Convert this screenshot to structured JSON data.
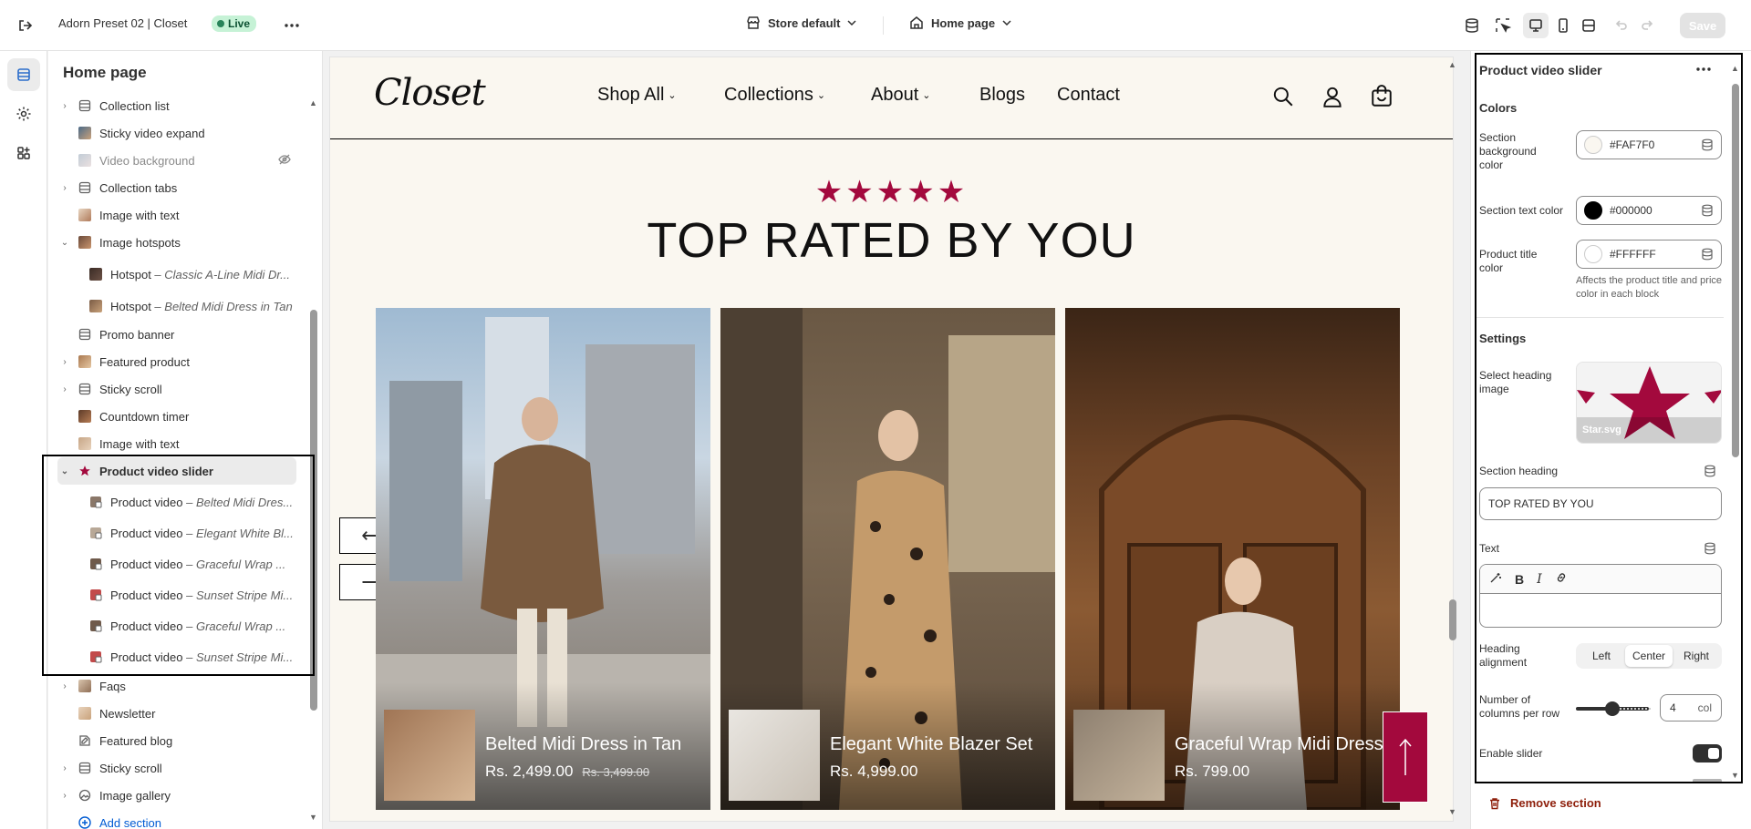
{
  "topbar": {
    "store_title": "Adorn Preset 02 | Closet",
    "live_label": "Live",
    "store_selector": "Store default",
    "page_selector": "Home page",
    "save_label": "Save"
  },
  "sidebar": {
    "title": "Home page",
    "items": [
      {
        "label": "Collection list"
      },
      {
        "label": "Sticky video expand"
      },
      {
        "label": "Video background"
      },
      {
        "label": "Collection tabs"
      },
      {
        "label": "Image with text"
      },
      {
        "label": "Image hotspots"
      },
      {
        "label": "Hotspot",
        "sub": "Classic A-Line Midi Dr..."
      },
      {
        "label": "Hotspot",
        "sub": "Belted Midi Dress in Tan"
      },
      {
        "label": "Promo banner"
      },
      {
        "label": "Featured product"
      },
      {
        "label": "Sticky scroll"
      },
      {
        "label": "Countdown timer"
      },
      {
        "label": "Image with text"
      },
      {
        "label": "Product video slider"
      },
      {
        "label": "Product video",
        "sub": "Belted Midi Dres..."
      },
      {
        "label": "Product video",
        "sub": "Elegant White Bl..."
      },
      {
        "label": "Product video",
        "sub": "Graceful Wrap ..."
      },
      {
        "label": "Product video",
        "sub": "Sunset Stripe Mi..."
      },
      {
        "label": "Product video",
        "sub": "Graceful Wrap ..."
      },
      {
        "label": "Product video",
        "sub": "Sunset Stripe Mi..."
      },
      {
        "label": "Faqs"
      },
      {
        "label": "Newsletter"
      },
      {
        "label": "Featured blog"
      },
      {
        "label": "Sticky scroll"
      },
      {
        "label": "Image gallery"
      },
      {
        "label": "Add section"
      }
    ]
  },
  "preview": {
    "logo": "Closet",
    "nav": [
      "Shop All",
      "Collections",
      "About",
      "Blogs",
      "Contact"
    ],
    "stars": "★★★★★",
    "heading": "TOP RATED BY YOU",
    "arrows": {
      "prev": "⟵",
      "next": "⟶"
    },
    "products": [
      {
        "title": "Belted Midi Dress in Tan",
        "price": "Rs. 2,499.00",
        "compare": "Rs. 3,499.00"
      },
      {
        "title": "Elegant White Blazer Set",
        "price": "Rs. 4,999.00",
        "compare": ""
      },
      {
        "title": "Graceful Wrap Midi Dress",
        "price": "Rs. 799.00",
        "compare": ""
      }
    ]
  },
  "inspector": {
    "title": "Product video slider",
    "colors_heading": "Colors",
    "bg_color_label": "Section background color",
    "bg_color_value": "#FAF7F0",
    "text_color_label": "Section text color",
    "text_color_value": "#000000",
    "title_color_label": "Product title color",
    "title_color_value": "#FFFFFF",
    "title_color_help": "Affects the product title and price color in each block",
    "settings_heading": "Settings",
    "heading_image_label": "Select heading image",
    "heading_image_file": "Star.svg",
    "section_heading_label": "Section heading",
    "section_heading_value": "TOP RATED BY YOU",
    "text_label": "Text",
    "alignment_label": "Heading alignment",
    "alignment_options": [
      "Left",
      "Center",
      "Right"
    ],
    "columns_label": "Number of columns per row",
    "columns_value": "4",
    "columns_unit": "col",
    "columns_fraction": 0.4,
    "enable_slider_label": "Enable slider",
    "enable_slider_on": true,
    "remove_label": "Remove section"
  },
  "colors": {
    "accent": "#a3093d",
    "bg": "#FAF7F0"
  }
}
